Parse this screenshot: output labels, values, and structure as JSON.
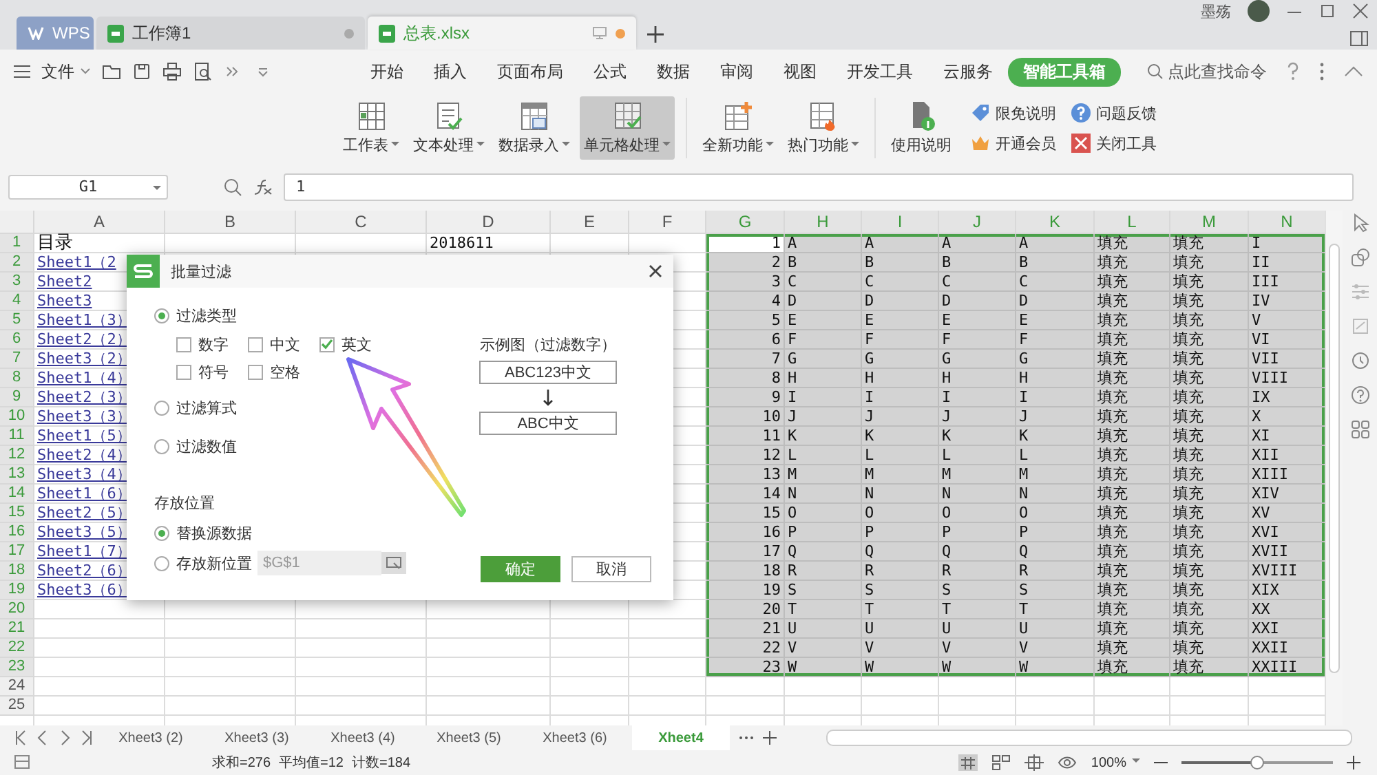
{
  "tabs": [
    {
      "label": "WPS",
      "kind": "home",
      "selected": false
    },
    {
      "label": "工作簿1",
      "kind": "doc",
      "selected": false,
      "modified": false
    },
    {
      "label": "总表.xlsx",
      "kind": "doc",
      "selected": true,
      "modified": true
    }
  ],
  "user": {
    "name": "墨殇"
  },
  "file_menu": {
    "label": "文件"
  },
  "ribbon_tabs": [
    {
      "label": "开始",
      "selected": false
    },
    {
      "label": "插入",
      "selected": false
    },
    {
      "label": "页面布局",
      "selected": false
    },
    {
      "label": "公式",
      "selected": false
    },
    {
      "label": "数据",
      "selected": false
    },
    {
      "label": "审阅",
      "selected": false
    },
    {
      "label": "视图",
      "selected": false
    },
    {
      "label": "开发工具",
      "selected": false
    },
    {
      "label": "云服务",
      "selected": false
    },
    {
      "label": "智能工具箱",
      "selected": true
    }
  ],
  "command_search": {
    "placeholder": "点此查找命令"
  },
  "ribbon_buttons": [
    {
      "label": "工作表",
      "selected": false
    },
    {
      "label": "文本处理",
      "selected": false
    },
    {
      "label": "数据录入",
      "selected": false
    },
    {
      "label": "单元格处理",
      "selected": true
    },
    {
      "label": "全新功能",
      "selected": false
    },
    {
      "label": "热门功能",
      "selected": false
    }
  ],
  "help_button": {
    "label": "使用说明"
  },
  "small_links": [
    {
      "label": "限免说明",
      "kind": "tag"
    },
    {
      "label": "问题反馈",
      "kind": "question"
    },
    {
      "label": "开通会员",
      "kind": "crown"
    },
    {
      "label": "关闭工具",
      "kind": "close"
    }
  ],
  "formula_bar": {
    "cell": "G1",
    "value": "1"
  },
  "sheet": {
    "columns": [
      {
        "label": "A",
        "selected": false
      },
      {
        "label": "B",
        "selected": false
      },
      {
        "label": "C",
        "selected": false
      },
      {
        "label": "D",
        "selected": false
      },
      {
        "label": "E",
        "selected": false
      },
      {
        "label": "F",
        "selected": false
      },
      {
        "label": "G",
        "selected": true
      },
      {
        "label": "H",
        "selected": true
      },
      {
        "label": "I",
        "selected": true
      },
      {
        "label": "J",
        "selected": true
      },
      {
        "label": "K",
        "selected": true
      },
      {
        "label": "L",
        "selected": true
      },
      {
        "label": "M",
        "selected": true
      },
      {
        "label": "N",
        "selected": true
      }
    ],
    "rows": [
      {
        "label": "1",
        "selected": true,
        "a": {
          "text": "目录",
          "link": false
        },
        "d": "2018611",
        "g": "1",
        "h": "A",
        "i": "A",
        "j": "A",
        "k": "A",
        "l": "填充",
        "m": "填充",
        "n": "I"
      },
      {
        "label": "2",
        "selected": true,
        "a": {
          "text": "Sheet1（2",
          "link": true
        },
        "g": "2",
        "h": "B",
        "i": "B",
        "j": "B",
        "k": "B",
        "l": "填充",
        "m": "填充",
        "n": "II"
      },
      {
        "label": "3",
        "selected": true,
        "a": {
          "text": "Sheet2",
          "link": true
        },
        "g": "3",
        "h": "C",
        "i": "C",
        "j": "C",
        "k": "C",
        "l": "填充",
        "m": "填充",
        "n": "III"
      },
      {
        "label": "4",
        "selected": true,
        "a": {
          "text": "Sheet3",
          "link": true
        },
        "g": "4",
        "h": "D",
        "i": "D",
        "j": "D",
        "k": "D",
        "l": "填充",
        "m": "填充",
        "n": "IV"
      },
      {
        "label": "5",
        "selected": true,
        "a": {
          "text": "Sheet1（3）",
          "link": true
        },
        "g": "5",
        "h": "E",
        "i": "E",
        "j": "E",
        "k": "E",
        "l": "填充",
        "m": "填充",
        "n": "V"
      },
      {
        "label": "6",
        "selected": true,
        "a": {
          "text": "Sheet2（2）",
          "link": true
        },
        "g": "6",
        "h": "F",
        "i": "F",
        "j": "F",
        "k": "F",
        "l": "填充",
        "m": "填充",
        "n": "VI"
      },
      {
        "label": "7",
        "selected": true,
        "a": {
          "text": "Sheet3（2）",
          "link": true
        },
        "g": "7",
        "h": "G",
        "i": "G",
        "j": "G",
        "k": "G",
        "l": "填充",
        "m": "填充",
        "n": "VII"
      },
      {
        "label": "8",
        "selected": true,
        "a": {
          "text": "Sheet1（4）",
          "link": true
        },
        "g": "8",
        "h": "H",
        "i": "H",
        "j": "H",
        "k": "H",
        "l": "填充",
        "m": "填充",
        "n": "VIII"
      },
      {
        "label": "9",
        "selected": true,
        "a": {
          "text": "Sheet2（3）",
          "link": true
        },
        "g": "9",
        "h": "I",
        "i": "I",
        "j": "I",
        "k": "I",
        "l": "填充",
        "m": "填充",
        "n": "IX"
      },
      {
        "label": "10",
        "selected": true,
        "a": {
          "text": "Sheet3（3）",
          "link": true
        },
        "g": "10",
        "h": "J",
        "i": "J",
        "j": "J",
        "k": "J",
        "l": "填充",
        "m": "填充",
        "n": "X"
      },
      {
        "label": "11",
        "selected": true,
        "a": {
          "text": "Sheet1（5）",
          "link": true
        },
        "g": "11",
        "h": "K",
        "i": "K",
        "j": "K",
        "k": "K",
        "l": "填充",
        "m": "填充",
        "n": "XI"
      },
      {
        "label": "12",
        "selected": true,
        "a": {
          "text": "Sheet2（4）",
          "link": true
        },
        "g": "12",
        "h": "L",
        "i": "L",
        "j": "L",
        "k": "L",
        "l": "填充",
        "m": "填充",
        "n": "XII"
      },
      {
        "label": "13",
        "selected": true,
        "a": {
          "text": "Sheet3（4）",
          "link": true
        },
        "g": "13",
        "h": "M",
        "i": "M",
        "j": "M",
        "k": "M",
        "l": "填充",
        "m": "填充",
        "n": "XIII"
      },
      {
        "label": "14",
        "selected": true,
        "a": {
          "text": "Sheet1（6）",
          "link": true
        },
        "g": "14",
        "h": "N",
        "i": "N",
        "j": "N",
        "k": "N",
        "l": "填充",
        "m": "填充",
        "n": "XIV"
      },
      {
        "label": "15",
        "selected": true,
        "a": {
          "text": "Sheet2（5）",
          "link": true
        },
        "g": "15",
        "h": "O",
        "i": "O",
        "j": "O",
        "k": "O",
        "l": "填充",
        "m": "填充",
        "n": "XV"
      },
      {
        "label": "16",
        "selected": true,
        "a": {
          "text": "Sheet3（5）",
          "link": true
        },
        "g": "16",
        "h": "P",
        "i": "P",
        "j": "P",
        "k": "P",
        "l": "填充",
        "m": "填充",
        "n": "XVI"
      },
      {
        "label": "17",
        "selected": true,
        "a": {
          "text": "Sheet1（7）",
          "link": true
        },
        "g": "17",
        "h": "Q",
        "i": "Q",
        "j": "Q",
        "k": "Q",
        "l": "填充",
        "m": "填充",
        "n": "XVII"
      },
      {
        "label": "18",
        "selected": true,
        "a": {
          "text": "Sheet2（6）",
          "link": true
        },
        "g": "18",
        "h": "R",
        "i": "R",
        "j": "R",
        "k": "R",
        "l": "填充",
        "m": "填充",
        "n": "XVIII"
      },
      {
        "label": "19",
        "selected": true,
        "a": {
          "text": "Sheet3（6）",
          "link": true
        },
        "g": "19",
        "h": "S",
        "i": "S",
        "j": "S",
        "k": "S",
        "l": "填充",
        "m": "填充",
        "n": "XIX"
      },
      {
        "label": "20",
        "selected": true,
        "g": "20",
        "h": "T",
        "i": "T",
        "j": "T",
        "k": "T",
        "l": "填充",
        "m": "填充",
        "n": "XX"
      },
      {
        "label": "21",
        "selected": true,
        "g": "21",
        "h": "U",
        "i": "U",
        "j": "U",
        "k": "U",
        "l": "填充",
        "m": "填充",
        "n": "XXI"
      },
      {
        "label": "22",
        "selected": true,
        "g": "22",
        "h": "V",
        "i": "V",
        "j": "V",
        "k": "V",
        "l": "填充",
        "m": "填充",
        "n": "XXII"
      },
      {
        "label": "23",
        "selected": true,
        "g": "23",
        "h": "W",
        "i": "W",
        "j": "W",
        "k": "W",
        "l": "填充",
        "m": "填充",
        "n": "XXIII"
      },
      {
        "label": "24",
        "selected": false
      },
      {
        "label": "25",
        "selected": false
      }
    ]
  },
  "dialog": {
    "title": "批量过滤",
    "options": [
      {
        "label": "过滤类型",
        "selected": true,
        "checkboxes": [
          {
            "label": "数字",
            "checked": false
          },
          {
            "label": "中文",
            "checked": false
          },
          {
            "label": "英文",
            "checked": true
          },
          {
            "label": "符号",
            "checked": false
          },
          {
            "label": "空格",
            "checked": false
          }
        ]
      },
      {
        "label": "过滤算式",
        "selected": false
      },
      {
        "label": "过滤数值",
        "selected": false
      }
    ],
    "example": {
      "title": "示例图（过滤数字）",
      "before": "ABC123中文",
      "after": "ABC中文"
    },
    "storage": {
      "heading": "存放位置",
      "options": [
        {
          "label": "替换源数据",
          "selected": true
        },
        {
          "label": "存放新位置",
          "selected": false
        }
      ],
      "location": {
        "placeholder": "$G$1"
      }
    },
    "buttons": [
      {
        "label": "确定",
        "kind": "primary"
      },
      {
        "label": "取消",
        "kind": "secondary"
      }
    ]
  },
  "sheet_tabs": [
    {
      "label": "Xheet3 (2)",
      "selected": false
    },
    {
      "label": "Xheet3 (3)",
      "selected": false
    },
    {
      "label": "Xheet3 (4)",
      "selected": false
    },
    {
      "label": "Xheet3 (5)",
      "selected": false
    },
    {
      "label": "Xheet3 (6)",
      "selected": false
    },
    {
      "label": "Xheet4",
      "selected": true
    }
  ],
  "status": {
    "sum": "求和=276",
    "average": "平均值=12",
    "count": "计数=184",
    "zoom": "100%",
    "zoom_slider": {
      "level": 0.5
    }
  }
}
